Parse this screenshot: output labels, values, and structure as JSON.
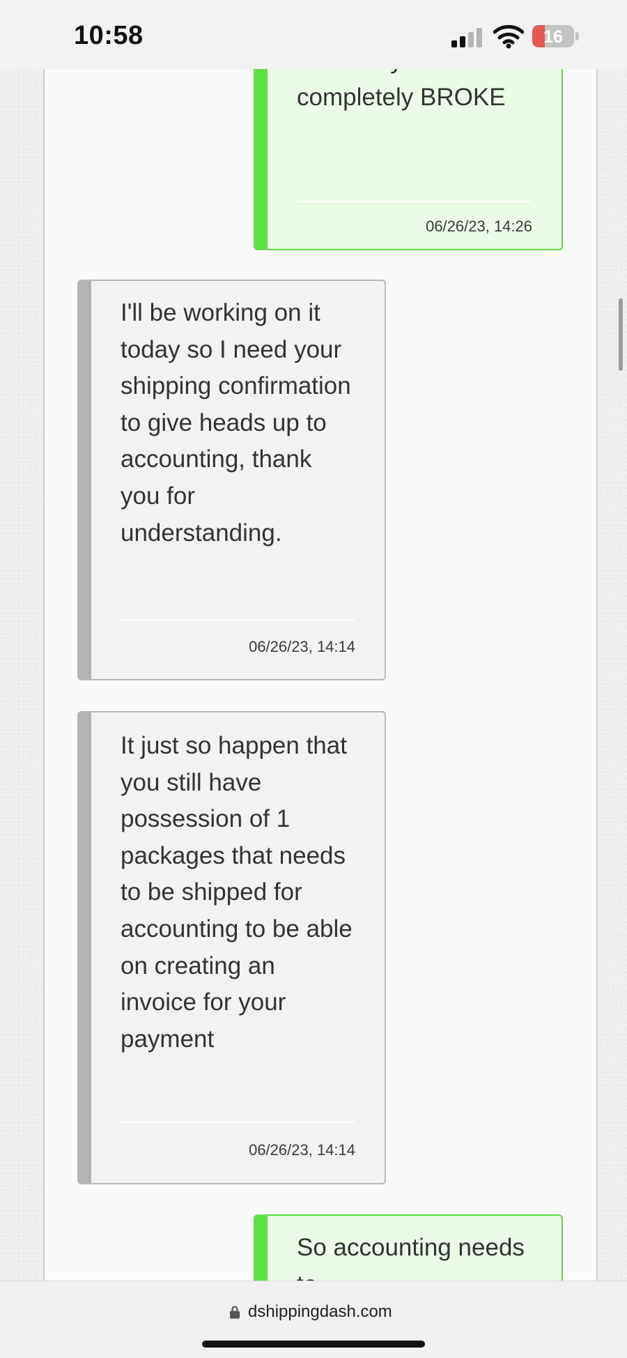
{
  "status_bar": {
    "time": "10:58",
    "battery_level": "16"
  },
  "messages": [
    {
      "direction": "outgoing",
      "text": "work for you but I am completely BROKE",
      "timestamp": "06/26/23, 14:26"
    },
    {
      "direction": "incoming",
      "text": "I'll be working on it today so I need your shipping confirmation to give heads up to accounting, thank you for understanding.",
      "timestamp": "06/26/23, 14:14"
    },
    {
      "direction": "incoming",
      "text": "It just so happen that you still have possession of 1 packages that needs to be shipped for accounting to be able on creating an invoice for your payment",
      "timestamp": "06/26/23, 14:14"
    },
    {
      "direction": "outgoing",
      "text": "So accounting needs to",
      "timestamp": ""
    }
  ],
  "browser": {
    "url": "dshippingdash.com"
  },
  "colors": {
    "outgoing_accent": "#5fe046",
    "outgoing_bg": "#ebfce6",
    "incoming_accent": "#b3b3b3",
    "incoming_bg": "#f2f2f2"
  },
  "icons": [
    "cellular-signal-icon",
    "wifi-icon",
    "battery-icon",
    "lock-icon"
  ]
}
